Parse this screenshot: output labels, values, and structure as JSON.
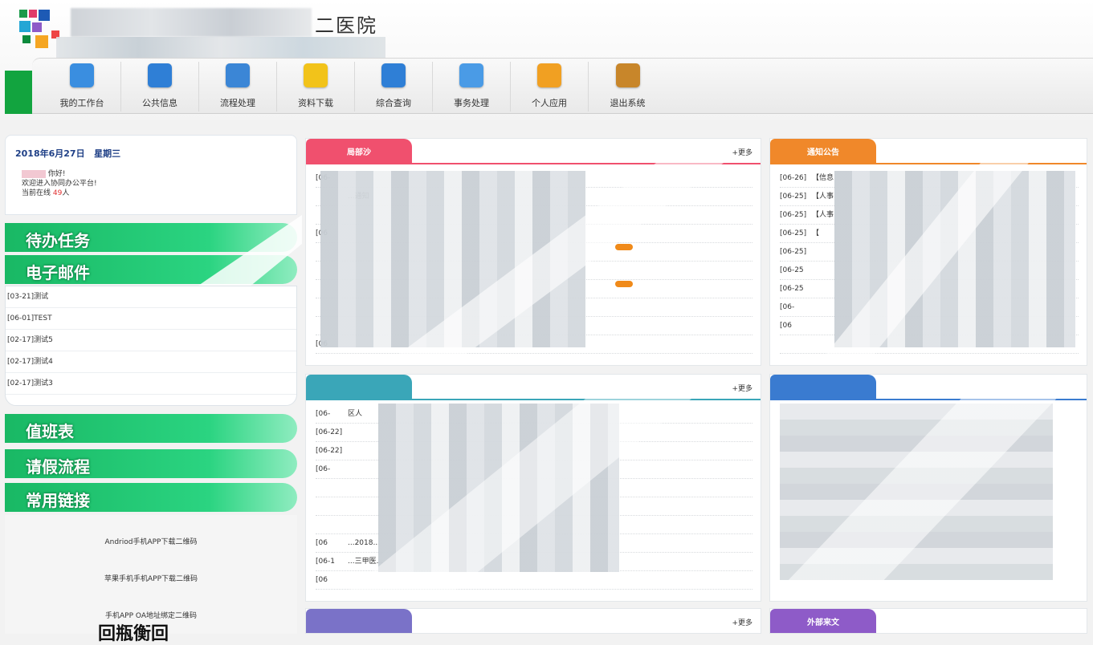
{
  "header": {
    "title_visible": "二医院",
    "colors": {
      "brand_green": "#12a43f"
    }
  },
  "toolbar": {
    "items": [
      {
        "label": "我的工作台",
        "icon": "workbench-icon",
        "color": "#3a8ee0"
      },
      {
        "label": "公共信息",
        "icon": "public-info-icon",
        "color": "#2f7fd6"
      },
      {
        "label": "流程处理",
        "icon": "workflow-icon",
        "color": "#3b86d6"
      },
      {
        "label": "资料下载",
        "icon": "folder-download-icon",
        "color": "#f2c31a"
      },
      {
        "label": "综合查询",
        "icon": "query-computer-icon",
        "color": "#2f7fd6"
      },
      {
        "label": "事务处理",
        "icon": "affairs-icon",
        "color": "#4a9be6"
      },
      {
        "label": "个人应用",
        "icon": "personal-app-icon",
        "color": "#f1a022"
      },
      {
        "label": "退出系统",
        "icon": "exit-door-icon",
        "color": "#c8862a"
      }
    ]
  },
  "sidebar": {
    "date": "2018年6月27日",
    "weekday": "星期三",
    "greeting": "你好!",
    "welcome": "欢迎进入协同办公平台!",
    "online_prefix": "当前在线",
    "online_count": "49",
    "online_suffix": "人",
    "todo_label": "待办任务",
    "mail_label": "电子邮件",
    "mails": [
      "[03-21]测试",
      "[06-01]TEST",
      "[02-17]测试5",
      "[02-17]测试4",
      "[02-17]测试3"
    ],
    "duty_label": "值班表",
    "leave_label": "请假流程",
    "links_label": "常用链接",
    "qr_links": [
      "Andriod手机APP下载二维码",
      "苹果手机手机APP下载二维码",
      "手机APP OA地址绑定二维码"
    ],
    "qr_bottom_text": "回瓶衡回"
  },
  "panels": {
    "p1": {
      "tab": "局部沙",
      "more": "+更多",
      "color": "#f0506e",
      "rows": [
        {
          "d": "[06-",
          "t": ""
        },
        {
          "d": "",
          "t": "...通知"
        },
        {
          "d": "",
          "t": ""
        },
        {
          "d": "[06",
          "t": ""
        },
        {
          "d": "",
          "t": ""
        },
        {
          "d": "",
          "t": ""
        },
        {
          "d": "",
          "t": ""
        },
        {
          "d": "",
          "t": ""
        },
        {
          "d": "",
          "t": ""
        },
        {
          "d": "[06",
          "t": ""
        }
      ]
    },
    "p2": {
      "tab": "通知公告",
      "color": "#f0882a",
      "rows": [
        {
          "d": "[06-26]",
          "t": "【信息"
        },
        {
          "d": "[06-25]",
          "t": "【人事"
        },
        {
          "d": "[06-25]",
          "t": "【人事"
        },
        {
          "d": "[06-25]",
          "t": "【"
        },
        {
          "d": "[06-25]",
          "t": ""
        },
        {
          "d": "[06-25",
          "t": ""
        },
        {
          "d": "[06-25",
          "t": ""
        },
        {
          "d": "[06-",
          "t": ""
        },
        {
          "d": "[06",
          "t": ""
        },
        {
          "d": "",
          "t": ""
        }
      ]
    },
    "p3": {
      "tab": "",
      "more": "+更多",
      "color": "#3aa6b8",
      "rows": [
        {
          "d": "[06-",
          "t": "区人"
        },
        {
          "d": "[06-22]",
          "t": ""
        },
        {
          "d": "[06-22]",
          "t": ""
        },
        {
          "d": "[06-",
          "t": ""
        },
        {
          "d": "",
          "t": ""
        },
        {
          "d": "",
          "t": ""
        },
        {
          "d": "",
          "t": ""
        },
        {
          "d": "[06",
          "t": "...2018..."
        },
        {
          "d": "[06-1",
          "t": "...三甲医..."
        },
        {
          "d": "[06",
          "t": ""
        }
      ]
    },
    "p4": {
      "tab": "",
      "color": "#3a7bd0",
      "rows": []
    },
    "p5": {
      "tab": "",
      "more": "+更多",
      "color": "#7a72c8"
    },
    "p6": {
      "tab": "外部来文",
      "color": "#8e5bc8"
    }
  }
}
